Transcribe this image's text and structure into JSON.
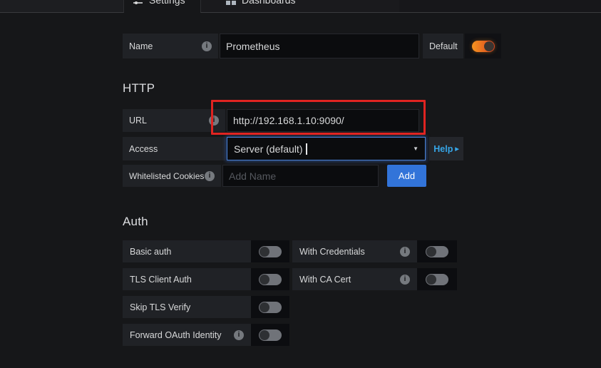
{
  "tabs": {
    "settings": {
      "label": "Settings",
      "icon": "sliders-icon",
      "active": true
    },
    "dashboards": {
      "label": "Dashboards",
      "icon": "apps-icon",
      "active": false
    }
  },
  "basics": {
    "name_label": "Name",
    "name_value": "Prometheus",
    "default_label": "Default",
    "default_enabled": true
  },
  "http": {
    "heading": "HTTP",
    "url_label": "URL",
    "url_value": "http://192.168.1.10:9090/",
    "access_label": "Access",
    "access_value": "Server (default)",
    "help_label": "Help",
    "whitelisted_cookies_label": "Whitelisted Cookies",
    "whitelisted_cookies_placeholder": "Add Name",
    "add_button_label": "Add"
  },
  "auth": {
    "heading": "Auth",
    "left": [
      {
        "label": "Basic auth",
        "has_info": false,
        "enabled": false
      },
      {
        "label": "TLS Client Auth",
        "has_info": false,
        "enabled": false
      },
      {
        "label": "Skip TLS Verify",
        "has_info": false,
        "enabled": false
      },
      {
        "label": "Forward OAuth Identity",
        "has_info": true,
        "enabled": false
      }
    ],
    "right": [
      {
        "label": "With Credentials",
        "has_info": true,
        "enabled": false
      },
      {
        "label": "With CA Cert",
        "has_info": true,
        "enabled": false
      }
    ]
  },
  "icons": {
    "info_glyph": "i",
    "caret_down_glyph": "▼",
    "help_arrow_glyph": "▶"
  },
  "colors": {
    "page_bg": "#161719",
    "label_bg": "#202226",
    "input_bg": "#0b0c0e",
    "accent_blue": "#3274d9",
    "help_link_blue": "#36a6e8",
    "focus_glow_blue": "#4a81d4",
    "toggle_on_gradient_start": "#f79520",
    "toggle_on_gradient_end": "#d6411f",
    "toggle_off_gray": "#707379",
    "annotation_red": "#e02421",
    "text_primary": "#d8d9da"
  }
}
